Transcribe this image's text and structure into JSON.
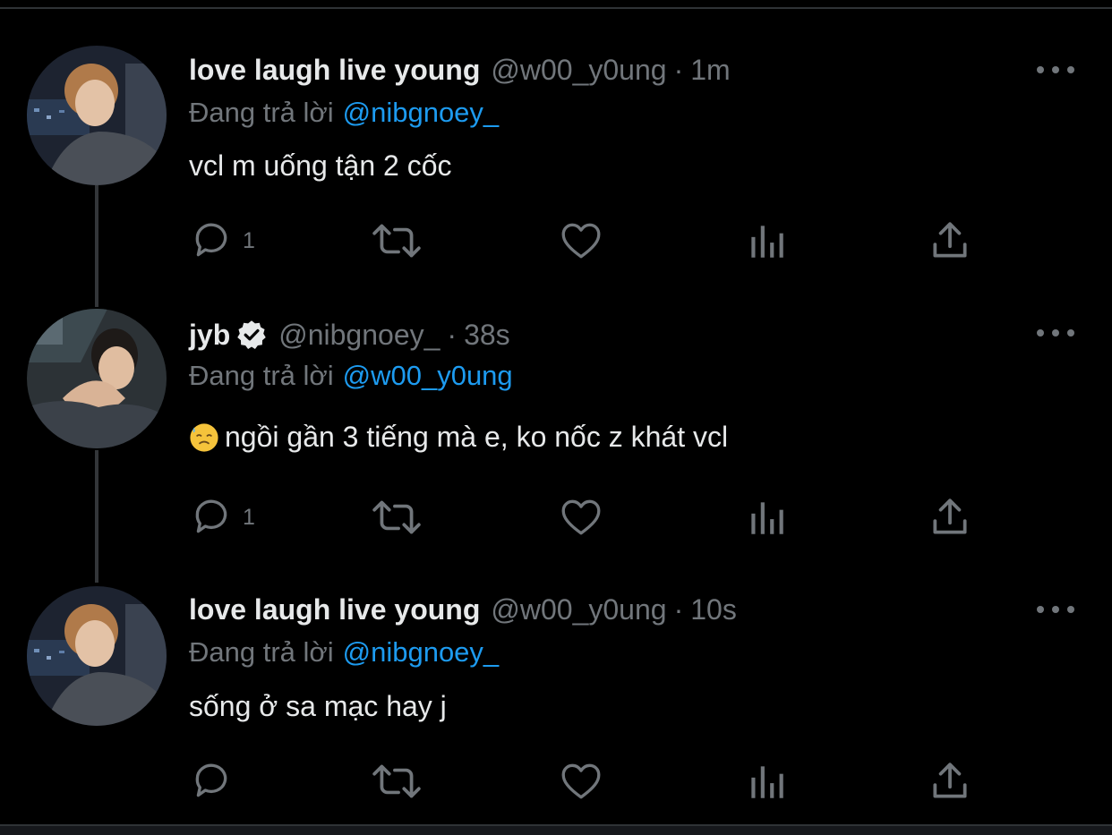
{
  "colors": {
    "background": "#000000",
    "text": "#e7e9ea",
    "muted": "#71767b",
    "accent": "#1d9bf0",
    "thread_line": "#333639"
  },
  "tweets": [
    {
      "display_name": "love laugh live young",
      "handle": "@w00_y0ung",
      "separator": "·",
      "time": "1m",
      "verified": false,
      "reply_prefix": "Đang trả lời",
      "reply_to": "@nibgnoey_",
      "text": "vcl m uống tận 2 cốc",
      "emoji": null,
      "reply_count": "1",
      "icons": [
        "reply-icon",
        "retweet-icon",
        "like-icon",
        "views-icon",
        "share-icon",
        "more-icon"
      ]
    },
    {
      "display_name": "jyb",
      "handle": "@nibgnoey_",
      "separator": "·",
      "time": "38s",
      "verified": true,
      "reply_prefix": "Đang trả lời",
      "reply_to": "@w00_y0ung",
      "text": "ngồi gần 3 tiếng mà e, ko nốc z khát vcl",
      "emoji": "downcast-face-with-sweat-icon",
      "reply_count": "1",
      "icons": [
        "reply-icon",
        "retweet-icon",
        "like-icon",
        "views-icon",
        "share-icon",
        "more-icon"
      ]
    },
    {
      "display_name": "love laugh live young",
      "handle": "@w00_y0ung",
      "separator": "·",
      "time": "10s",
      "verified": false,
      "reply_prefix": "Đang trả lời",
      "reply_to": "@nibgnoey_",
      "text": "sống ở sa mạc hay j",
      "emoji": null,
      "reply_count": "",
      "icons": [
        "reply-icon",
        "retweet-icon",
        "like-icon",
        "views-icon",
        "share-icon",
        "more-icon"
      ]
    }
  ]
}
